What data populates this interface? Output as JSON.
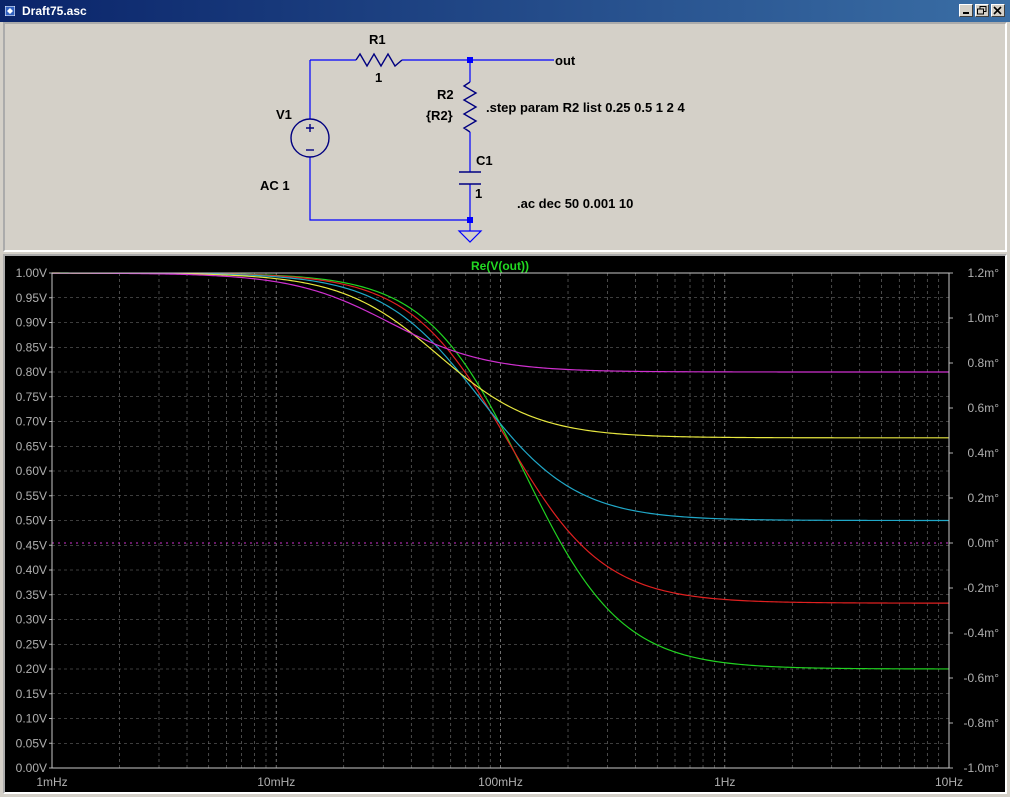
{
  "window": {
    "title": "Draft75.asc"
  },
  "schematic": {
    "r1": {
      "name": "R1",
      "value": "1"
    },
    "r2": {
      "name": "R2",
      "value": "{R2}"
    },
    "c1": {
      "name": "C1",
      "value": "1"
    },
    "v1": {
      "name": "V1",
      "value": "AC 1"
    },
    "net_out": "out",
    "directive_step": ".step param R2 list  0.25 0.5 1 2  4",
    "directive_ac": ".ac dec 50 0.001 10"
  },
  "colors": {
    "plot_bg": "#000000",
    "grid": "#7a7a7a",
    "axis_text": "#b0b0b0",
    "title": "#22d922",
    "wire": "#0000ff",
    "junction": "#0000ff",
    "component": "#000080"
  },
  "chart_data": {
    "type": "line",
    "title": "Re(V(out))",
    "x_scale": "log",
    "xlim": [
      0.001,
      10
    ],
    "x_ticks": [
      0.001,
      0.01,
      0.1,
      1,
      10
    ],
    "x_tick_labels": [
      "1mHz",
      "10mHz",
      "100mHz",
      "1Hz",
      "10Hz"
    ],
    "ylim": [
      0,
      1
    ],
    "y_ticks": [
      0,
      0.05,
      0.1,
      0.15,
      0.2,
      0.25,
      0.3,
      0.35,
      0.4,
      0.45,
      0.5,
      0.55,
      0.6,
      0.65,
      0.7,
      0.75,
      0.8,
      0.85,
      0.9,
      0.95,
      1.0
    ],
    "y_tick_labels": [
      "0.00V",
      "0.05V",
      "0.10V",
      "0.15V",
      "0.20V",
      "0.25V",
      "0.30V",
      "0.35V",
      "0.40V",
      "0.45V",
      "0.50V",
      "0.55V",
      "0.60V",
      "0.65V",
      "0.70V",
      "0.75V",
      "0.80V",
      "0.85V",
      "0.90V",
      "0.95V",
      "1.00V"
    ],
    "y2lim": [
      -1.0,
      1.2
    ],
    "y2_ticks": [
      -1.0,
      -0.8,
      -0.6,
      -0.4,
      -0.2,
      0.0,
      0.2,
      0.4,
      0.6,
      0.8,
      1.0,
      1.2
    ],
    "y2_tick_labels": [
      "-1.0m°",
      "-0.8m°",
      "-0.6m°",
      "-0.4m°",
      "-0.2m°",
      "0.0m°",
      "0.2m°",
      "0.4m°",
      "0.6m°",
      "0.8m°",
      "1.0m°",
      "1.2m°"
    ],
    "grid": true,
    "series": [
      {
        "r2": 0.25,
        "color": "#21d321",
        "hf_value": 0.2,
        "corner_hz": 0.127
      },
      {
        "r2": 0.5,
        "color": "#e02020",
        "hf_value": 0.333,
        "corner_hz": 0.106
      },
      {
        "r2": 1,
        "color": "#20a8c8",
        "hf_value": 0.5,
        "corner_hz": 0.08
      },
      {
        "r2": 2,
        "color": "#e8e840",
        "hf_value": 0.667,
        "corner_hz": 0.053
      },
      {
        "r2": 4,
        "color": "#d030d0",
        "hf_value": 0.8,
        "corner_hz": 0.032
      }
    ],
    "phase_trace": {
      "color": "#d030d0",
      "value": 0.0
    }
  }
}
